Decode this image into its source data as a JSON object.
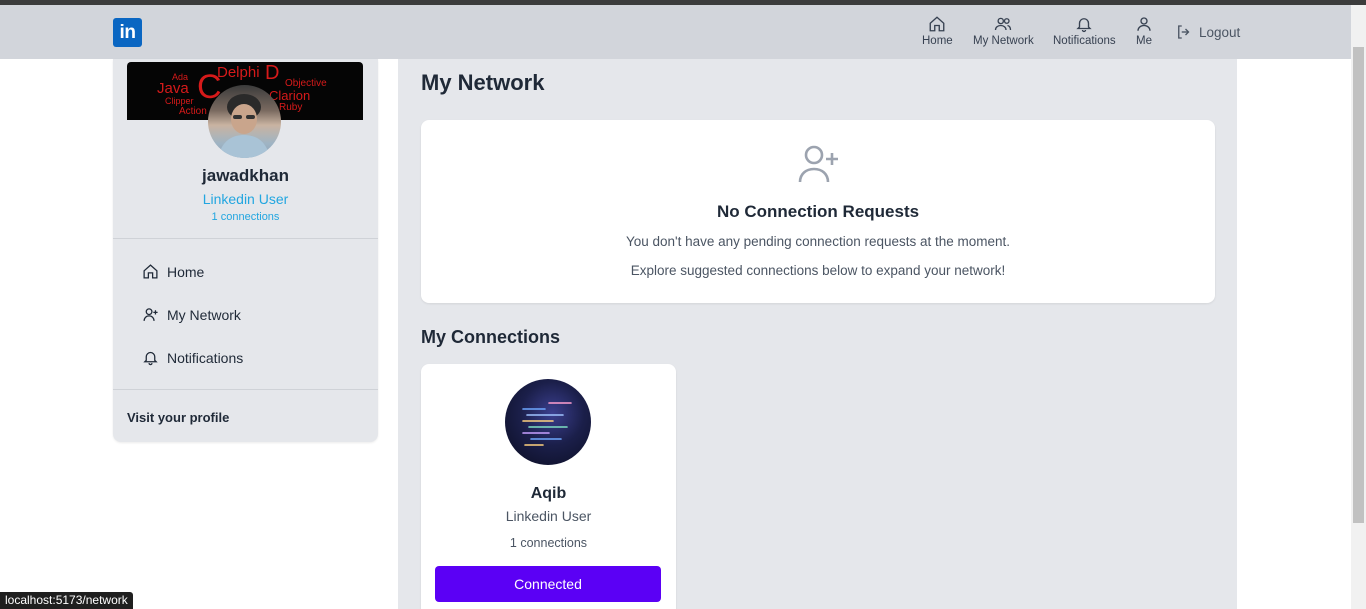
{
  "navbar": {
    "logo_text": "in",
    "items": [
      {
        "label": "Home",
        "icon": "home-icon"
      },
      {
        "label": "My Network",
        "icon": "users-icon"
      },
      {
        "label": "Notifications",
        "icon": "bell-icon"
      },
      {
        "label": "Me",
        "icon": "user-icon"
      }
    ],
    "logout_label": "Logout"
  },
  "sidebar": {
    "cover_words": [
      "Delphi",
      "Java",
      "Ada",
      "Objective",
      "Clarion",
      "Ruby",
      "Clipper",
      "Action",
      "C",
      "D"
    ],
    "name": "jawadkhan",
    "role": "Linkedin User",
    "connections": "1 connections",
    "menu": [
      {
        "label": "Home",
        "icon": "home-icon"
      },
      {
        "label": "My Network",
        "icon": "user-plus-icon"
      },
      {
        "label": "Notifications",
        "icon": "bell-icon"
      }
    ],
    "visit_profile": "Visit your profile"
  },
  "main": {
    "title": "My Network",
    "requests": {
      "title": "No Connection Requests",
      "line1": "You don't have any pending connection requests at the moment.",
      "line2": "Explore suggested connections below to expand your network!"
    },
    "connections_title": "My Connections",
    "connections": [
      {
        "name": "Aqib",
        "role": "Linkedin User",
        "count": "1 connections",
        "button": "Connected"
      }
    ]
  },
  "status_bar": "localhost:5173/network",
  "colors": {
    "brand": "#0a66c2",
    "accent": "#5b00f5",
    "link": "#22a6e0"
  }
}
